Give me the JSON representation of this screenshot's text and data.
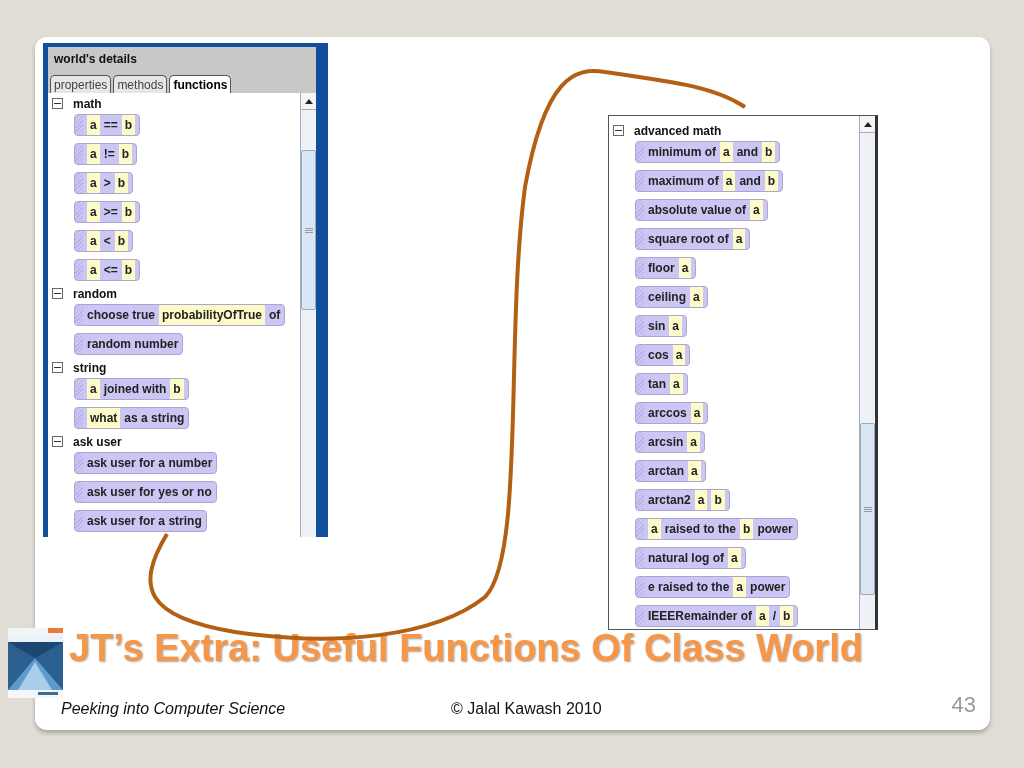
{
  "left_panel": {
    "title": "world's details",
    "tabs": [
      {
        "label": "properties",
        "selected": false
      },
      {
        "label": "methods",
        "selected": false
      },
      {
        "label": "functions",
        "selected": true
      }
    ],
    "groups": [
      {
        "label": "math",
        "expanded": true,
        "tiles": [
          [
            {
              "kind": "slot",
              "text": "a"
            },
            {
              "kind": "text",
              "text": "=="
            },
            {
              "kind": "slot",
              "text": "b"
            }
          ],
          [
            {
              "kind": "slot",
              "text": "a"
            },
            {
              "kind": "text",
              "text": "!="
            },
            {
              "kind": "slot",
              "text": "b"
            }
          ],
          [
            {
              "kind": "slot",
              "text": "a"
            },
            {
              "kind": "text",
              "text": ">"
            },
            {
              "kind": "slot",
              "text": "b"
            }
          ],
          [
            {
              "kind": "slot",
              "text": "a"
            },
            {
              "kind": "text",
              "text": ">="
            },
            {
              "kind": "slot",
              "text": "b"
            }
          ],
          [
            {
              "kind": "slot",
              "text": "a"
            },
            {
              "kind": "text",
              "text": "<"
            },
            {
              "kind": "slot",
              "text": "b"
            }
          ],
          [
            {
              "kind": "slot",
              "text": "a"
            },
            {
              "kind": "text",
              "text": "<="
            },
            {
              "kind": "slot",
              "text": "b"
            }
          ]
        ]
      },
      {
        "label": "random",
        "expanded": true,
        "tiles": [
          [
            {
              "kind": "text",
              "text": "choose true"
            },
            {
              "kind": "slot",
              "text": "probabilityOfTrue"
            },
            {
              "kind": "text",
              "text": "of"
            }
          ],
          [
            {
              "kind": "text",
              "text": "random number"
            }
          ]
        ]
      },
      {
        "label": "string",
        "expanded": true,
        "tiles": [
          [
            {
              "kind": "slot",
              "text": "a"
            },
            {
              "kind": "text",
              "text": "joined with"
            },
            {
              "kind": "slot",
              "text": "b"
            }
          ],
          [
            {
              "kind": "slot",
              "text": "what"
            },
            {
              "kind": "text",
              "text": "as a string"
            }
          ]
        ]
      },
      {
        "label": "ask user",
        "expanded": true,
        "tiles": [
          [
            {
              "kind": "text",
              "text": "ask user for a number"
            }
          ],
          [
            {
              "kind": "text",
              "text": "ask user for yes or no"
            }
          ],
          [
            {
              "kind": "text",
              "text": "ask user for a string"
            }
          ]
        ]
      }
    ]
  },
  "right_panel": {
    "groups": [
      {
        "label": "advanced math",
        "expanded": true,
        "tiles": [
          [
            {
              "kind": "text",
              "text": "minimum of"
            },
            {
              "kind": "slot",
              "text": "a"
            },
            {
              "kind": "text",
              "text": "and"
            },
            {
              "kind": "slot",
              "text": "b"
            }
          ],
          [
            {
              "kind": "text",
              "text": "maximum of"
            },
            {
              "kind": "slot",
              "text": "a"
            },
            {
              "kind": "text",
              "text": "and"
            },
            {
              "kind": "slot",
              "text": "b"
            }
          ],
          [
            {
              "kind": "text",
              "text": "absolute value of"
            },
            {
              "kind": "slot",
              "text": "a"
            }
          ],
          [
            {
              "kind": "text",
              "text": "square root of"
            },
            {
              "kind": "slot",
              "text": "a"
            }
          ],
          [
            {
              "kind": "text",
              "text": "floor"
            },
            {
              "kind": "slot",
              "text": "a"
            }
          ],
          [
            {
              "kind": "text",
              "text": "ceiling"
            },
            {
              "kind": "slot",
              "text": "a"
            }
          ],
          [
            {
              "kind": "text",
              "text": "sin"
            },
            {
              "kind": "slot",
              "text": "a"
            }
          ],
          [
            {
              "kind": "text",
              "text": "cos"
            },
            {
              "kind": "slot",
              "text": "a"
            }
          ],
          [
            {
              "kind": "text",
              "text": "tan"
            },
            {
              "kind": "slot",
              "text": "a"
            }
          ],
          [
            {
              "kind": "text",
              "text": "arccos"
            },
            {
              "kind": "slot",
              "text": "a"
            }
          ],
          [
            {
              "kind": "text",
              "text": "arcsin"
            },
            {
              "kind": "slot",
              "text": "a"
            }
          ],
          [
            {
              "kind": "text",
              "text": "arctan"
            },
            {
              "kind": "slot",
              "text": "a"
            }
          ],
          [
            {
              "kind": "text",
              "text": "arctan2"
            },
            {
              "kind": "slot",
              "text": "a"
            },
            {
              "kind": "slot",
              "text": "b"
            }
          ],
          [
            {
              "kind": "slot",
              "text": "a"
            },
            {
              "kind": "text",
              "text": "raised to the"
            },
            {
              "kind": "slot",
              "text": "b"
            },
            {
              "kind": "text",
              "text": "power"
            }
          ],
          [
            {
              "kind": "text",
              "text": "natural log of"
            },
            {
              "kind": "slot",
              "text": "a"
            }
          ],
          [
            {
              "kind": "text",
              "text": "e raised to the"
            },
            {
              "kind": "slot",
              "text": "a"
            },
            {
              "kind": "text",
              "text": "power"
            }
          ],
          [
            {
              "kind": "text",
              "text": "IEEERemainder of"
            },
            {
              "kind": "slot",
              "text": "a"
            },
            {
              "kind": "text",
              "text": "/"
            },
            {
              "kind": "slot",
              "text": "b"
            }
          ]
        ]
      }
    ]
  },
  "slide": {
    "title": "JT’s Extra: Useful Functions Of Class World",
    "footer_left": "Peeking into Computer Science",
    "footer_center": "© Jalal Kawash 2010",
    "page_number": "43"
  }
}
